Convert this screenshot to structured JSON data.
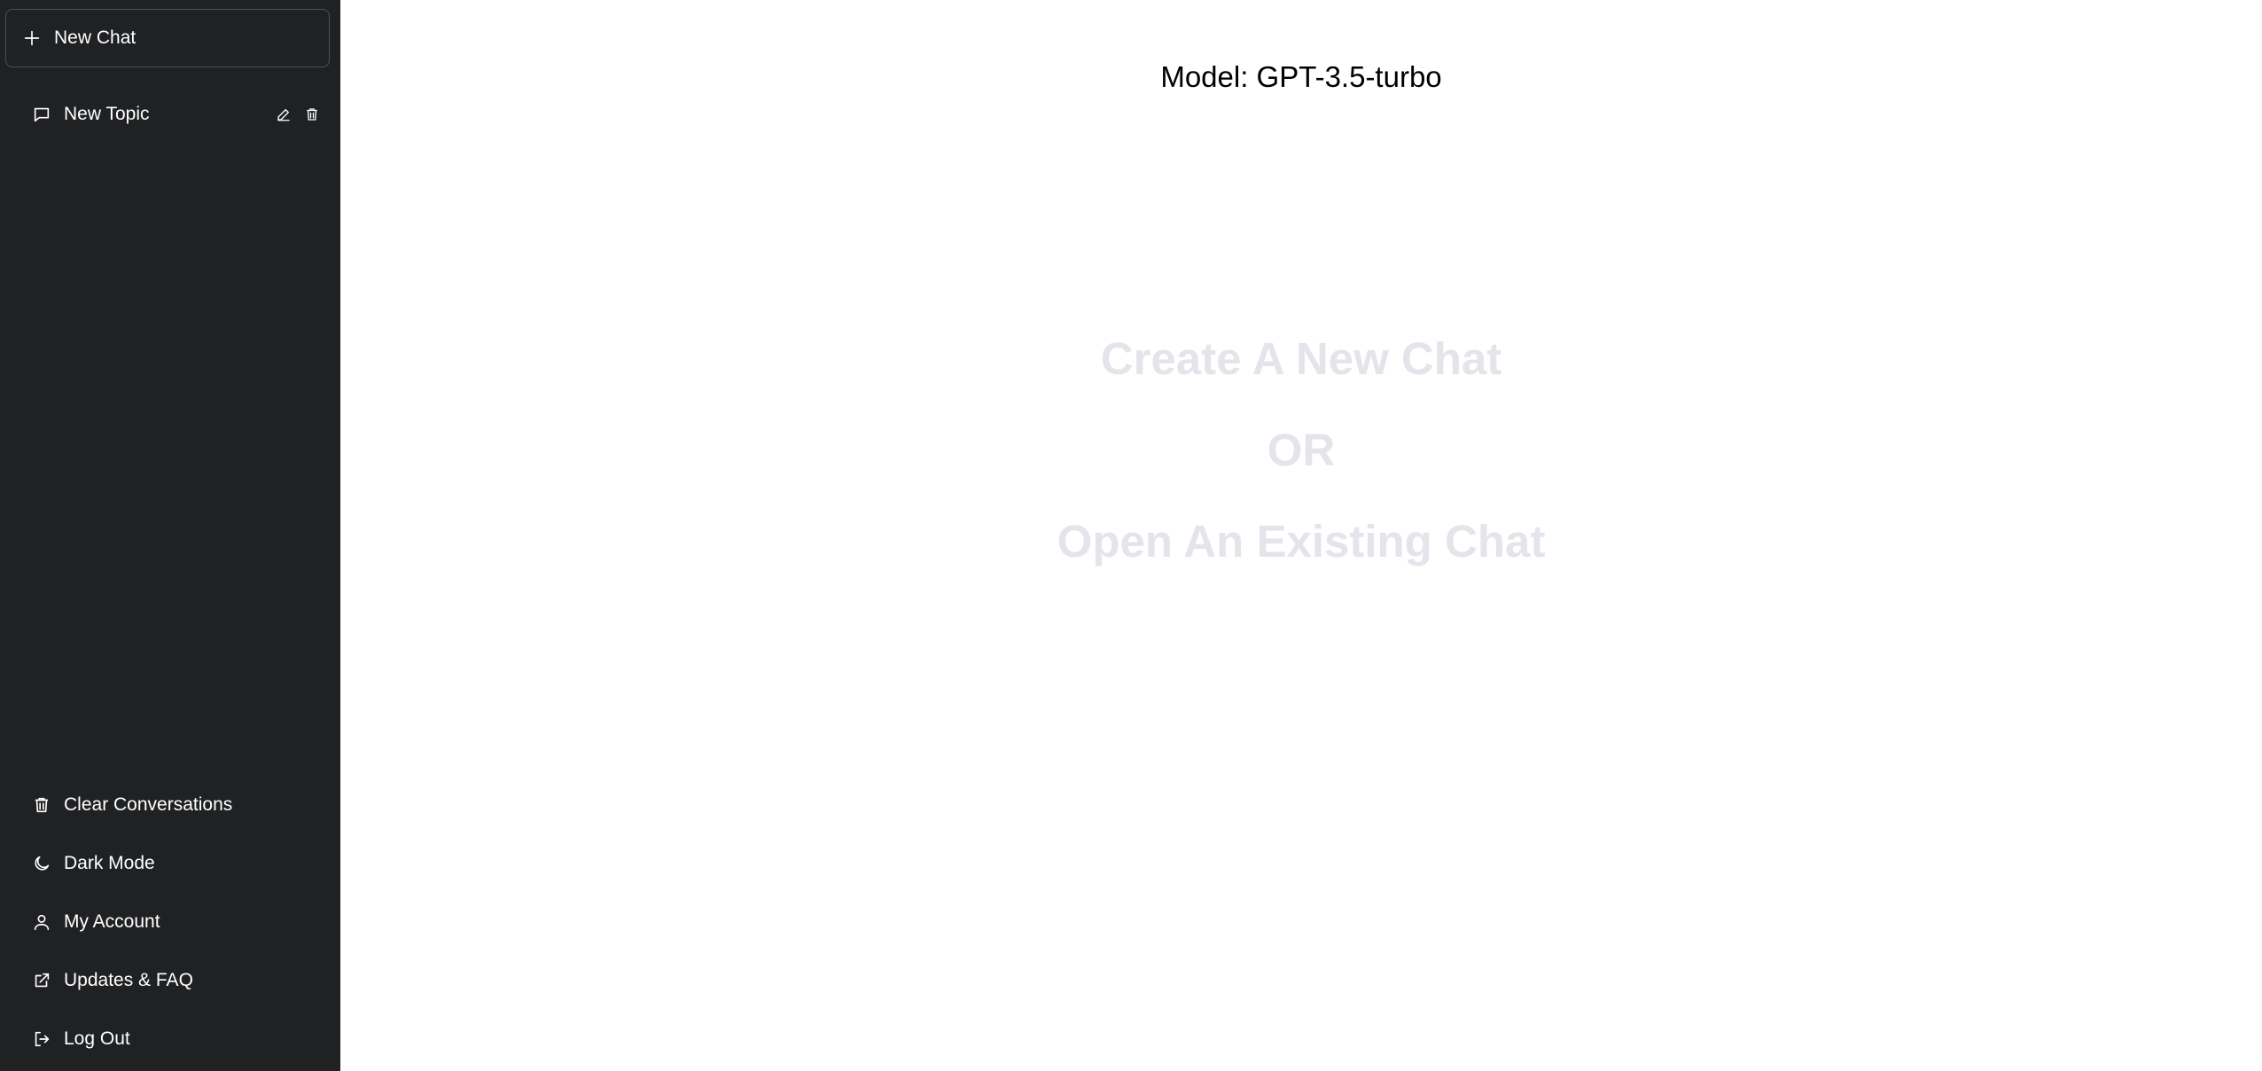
{
  "sidebar": {
    "new_chat_label": "New Chat",
    "topics": [
      {
        "label": "New Topic"
      }
    ],
    "menu": [
      {
        "label": "Clear Conversations",
        "icon": "trash-icon"
      },
      {
        "label": "Dark Mode",
        "icon": "moon-icon"
      },
      {
        "label": "My Account",
        "icon": "user-icon"
      },
      {
        "label": "Updates & FAQ",
        "icon": "external-link-icon"
      },
      {
        "label": "Log Out",
        "icon": "logout-icon"
      }
    ]
  },
  "main": {
    "model_label": "Model: GPT-3.5-turbo",
    "empty_state": {
      "line1": "Create A New Chat",
      "line2": "OR",
      "line3": "Open An Existing Chat"
    }
  },
  "colors": {
    "sidebar_bg": "#202123",
    "empty_state_text": "#e4e4ea"
  }
}
